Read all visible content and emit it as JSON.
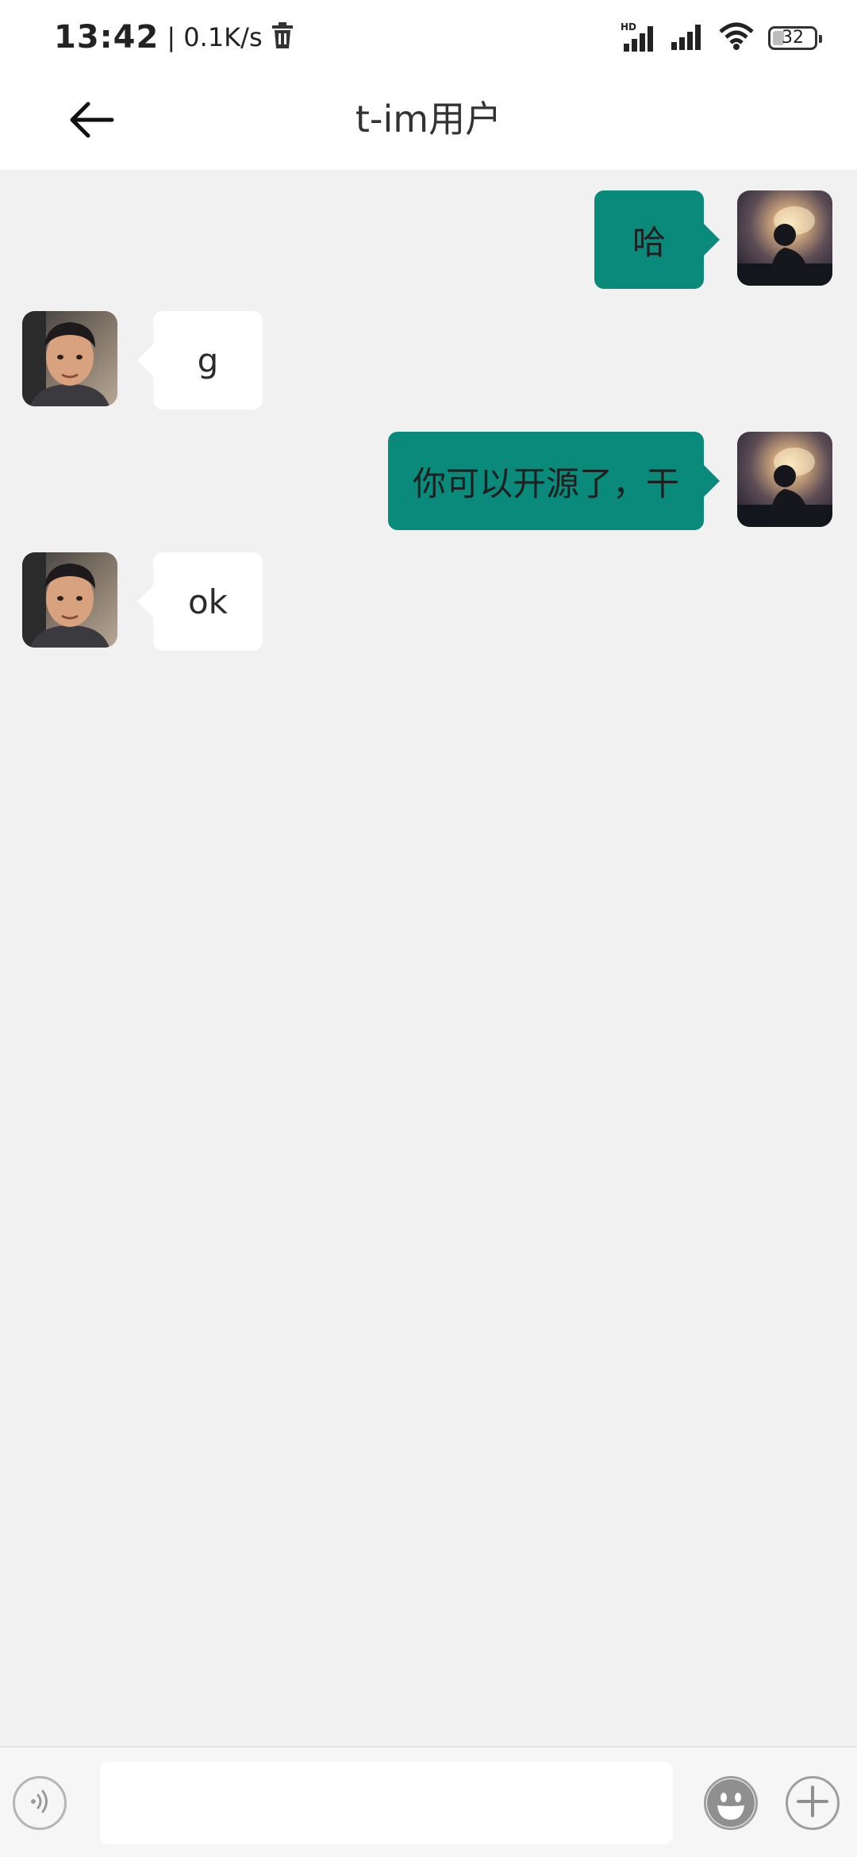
{
  "status_bar": {
    "time": "13:42",
    "net_speed": "| 0.1K/s",
    "signal_label": "HD",
    "battery_level": "32",
    "icons": [
      "trash-icon",
      "hd-signal-icon",
      "signal-icon",
      "wifi-icon",
      "battery-icon"
    ]
  },
  "header": {
    "title": "t-im用户",
    "back_icon": "arrow-left-icon"
  },
  "messages": [
    {
      "direction": "sent",
      "text": "哈",
      "avatar": "sunset-silhouette-avatar"
    },
    {
      "direction": "received",
      "text": "g",
      "avatar": "boy-portrait-avatar"
    },
    {
      "direction": "sent",
      "text": "你可以开源了，干",
      "avatar": "sunset-silhouette-avatar"
    },
    {
      "direction": "received",
      "text": "ok",
      "avatar": "boy-portrait-avatar"
    }
  ],
  "input_bar": {
    "message_value": "",
    "message_placeholder": "",
    "icons": [
      "voice-icon",
      "emoji-icon",
      "plus-icon"
    ]
  },
  "colors": {
    "accent": "#0a8a7a",
    "background": "#f1f1f2",
    "bar": "#ffffff"
  }
}
